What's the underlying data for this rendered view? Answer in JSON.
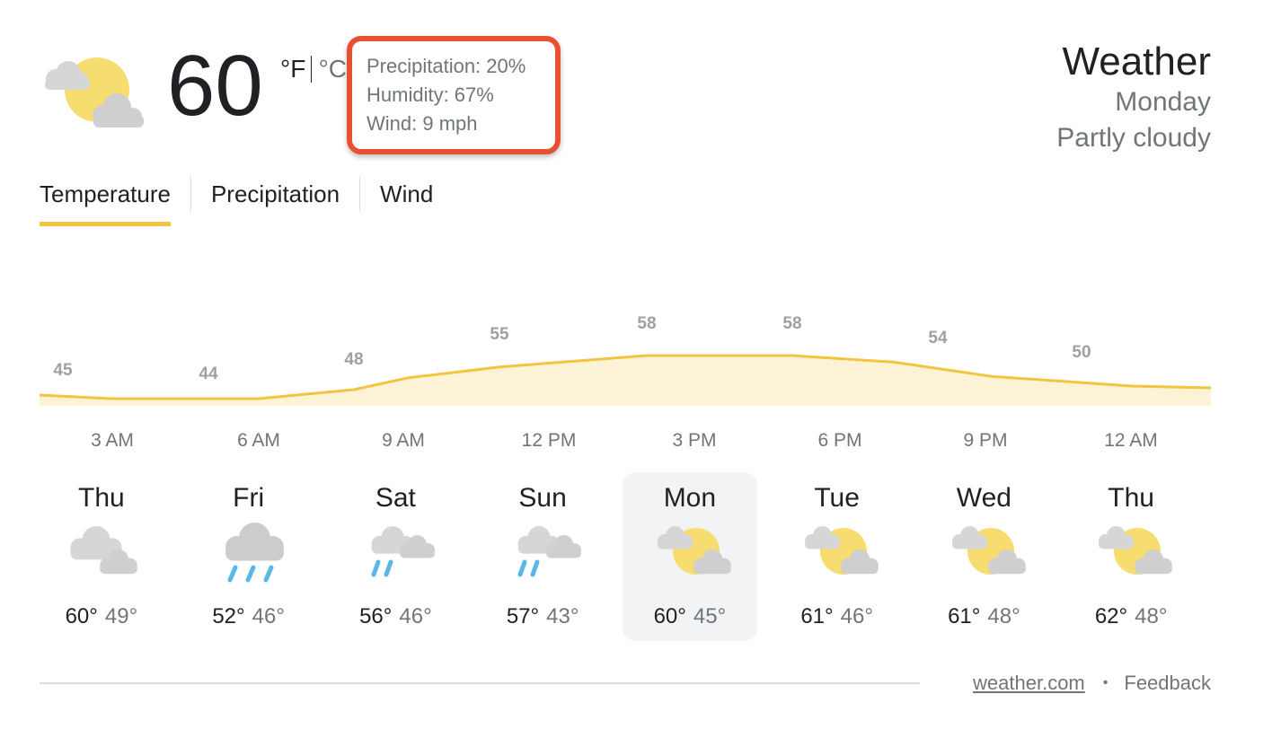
{
  "current": {
    "temperature": "60",
    "unit_f": "°F",
    "unit_c": "°C",
    "icon": "partly-cloudy-icon",
    "details": {
      "precipitation": "Precipitation: 20%",
      "humidity": "Humidity: 67%",
      "wind": "Wind: 9 mph"
    }
  },
  "header": {
    "title": "Weather",
    "day": "Monday",
    "condition": "Partly cloudy"
  },
  "tabs": [
    {
      "label": "Temperature",
      "active": true
    },
    {
      "label": "Precipitation",
      "active": false
    },
    {
      "label": "Wind",
      "active": false
    }
  ],
  "colors": {
    "accent": "#f2c43f",
    "highlight_border": "#e8502e",
    "chart_fill": "#fcf3d6",
    "chart_line": "#f2c43f",
    "rain": "#5bb8e6",
    "cloud": "#d6d6d6",
    "sun": "#f7dc6f"
  },
  "chart_data": {
    "type": "area",
    "labels": [
      "45",
      "44",
      "48",
      "55",
      "58",
      "58",
      "54",
      "50"
    ],
    "values": [
      45,
      44,
      48,
      55,
      58,
      58,
      54,
      50
    ],
    "hours": [
      "3 AM",
      "6 AM",
      "9 AM",
      "12 PM",
      "3 PM",
      "6 PM",
      "9 PM",
      "12 AM"
    ]
  },
  "days": [
    {
      "name": "Thu",
      "icon": "cloudy-icon",
      "hi": "60°",
      "lo": "49°",
      "selected": false
    },
    {
      "name": "Fri",
      "icon": "rain-icon",
      "hi": "52°",
      "lo": "46°",
      "selected": false
    },
    {
      "name": "Sat",
      "icon": "showers-icon",
      "hi": "56°",
      "lo": "46°",
      "selected": false
    },
    {
      "name": "Sun",
      "icon": "showers-icon",
      "hi": "57°",
      "lo": "43°",
      "selected": false
    },
    {
      "name": "Mon",
      "icon": "partly-cloudy-icon",
      "hi": "60°",
      "lo": "45°",
      "selected": true
    },
    {
      "name": "Tue",
      "icon": "partly-cloudy-icon",
      "hi": "61°",
      "lo": "46°",
      "selected": false
    },
    {
      "name": "Wed",
      "icon": "partly-cloudy-icon",
      "hi": "61°",
      "lo": "48°",
      "selected": false
    },
    {
      "name": "Thu",
      "icon": "partly-cloudy-icon",
      "hi": "62°",
      "lo": "48°",
      "selected": false
    }
  ],
  "footer": {
    "source_link": "weather.com",
    "separator": "•",
    "feedback": "Feedback"
  }
}
